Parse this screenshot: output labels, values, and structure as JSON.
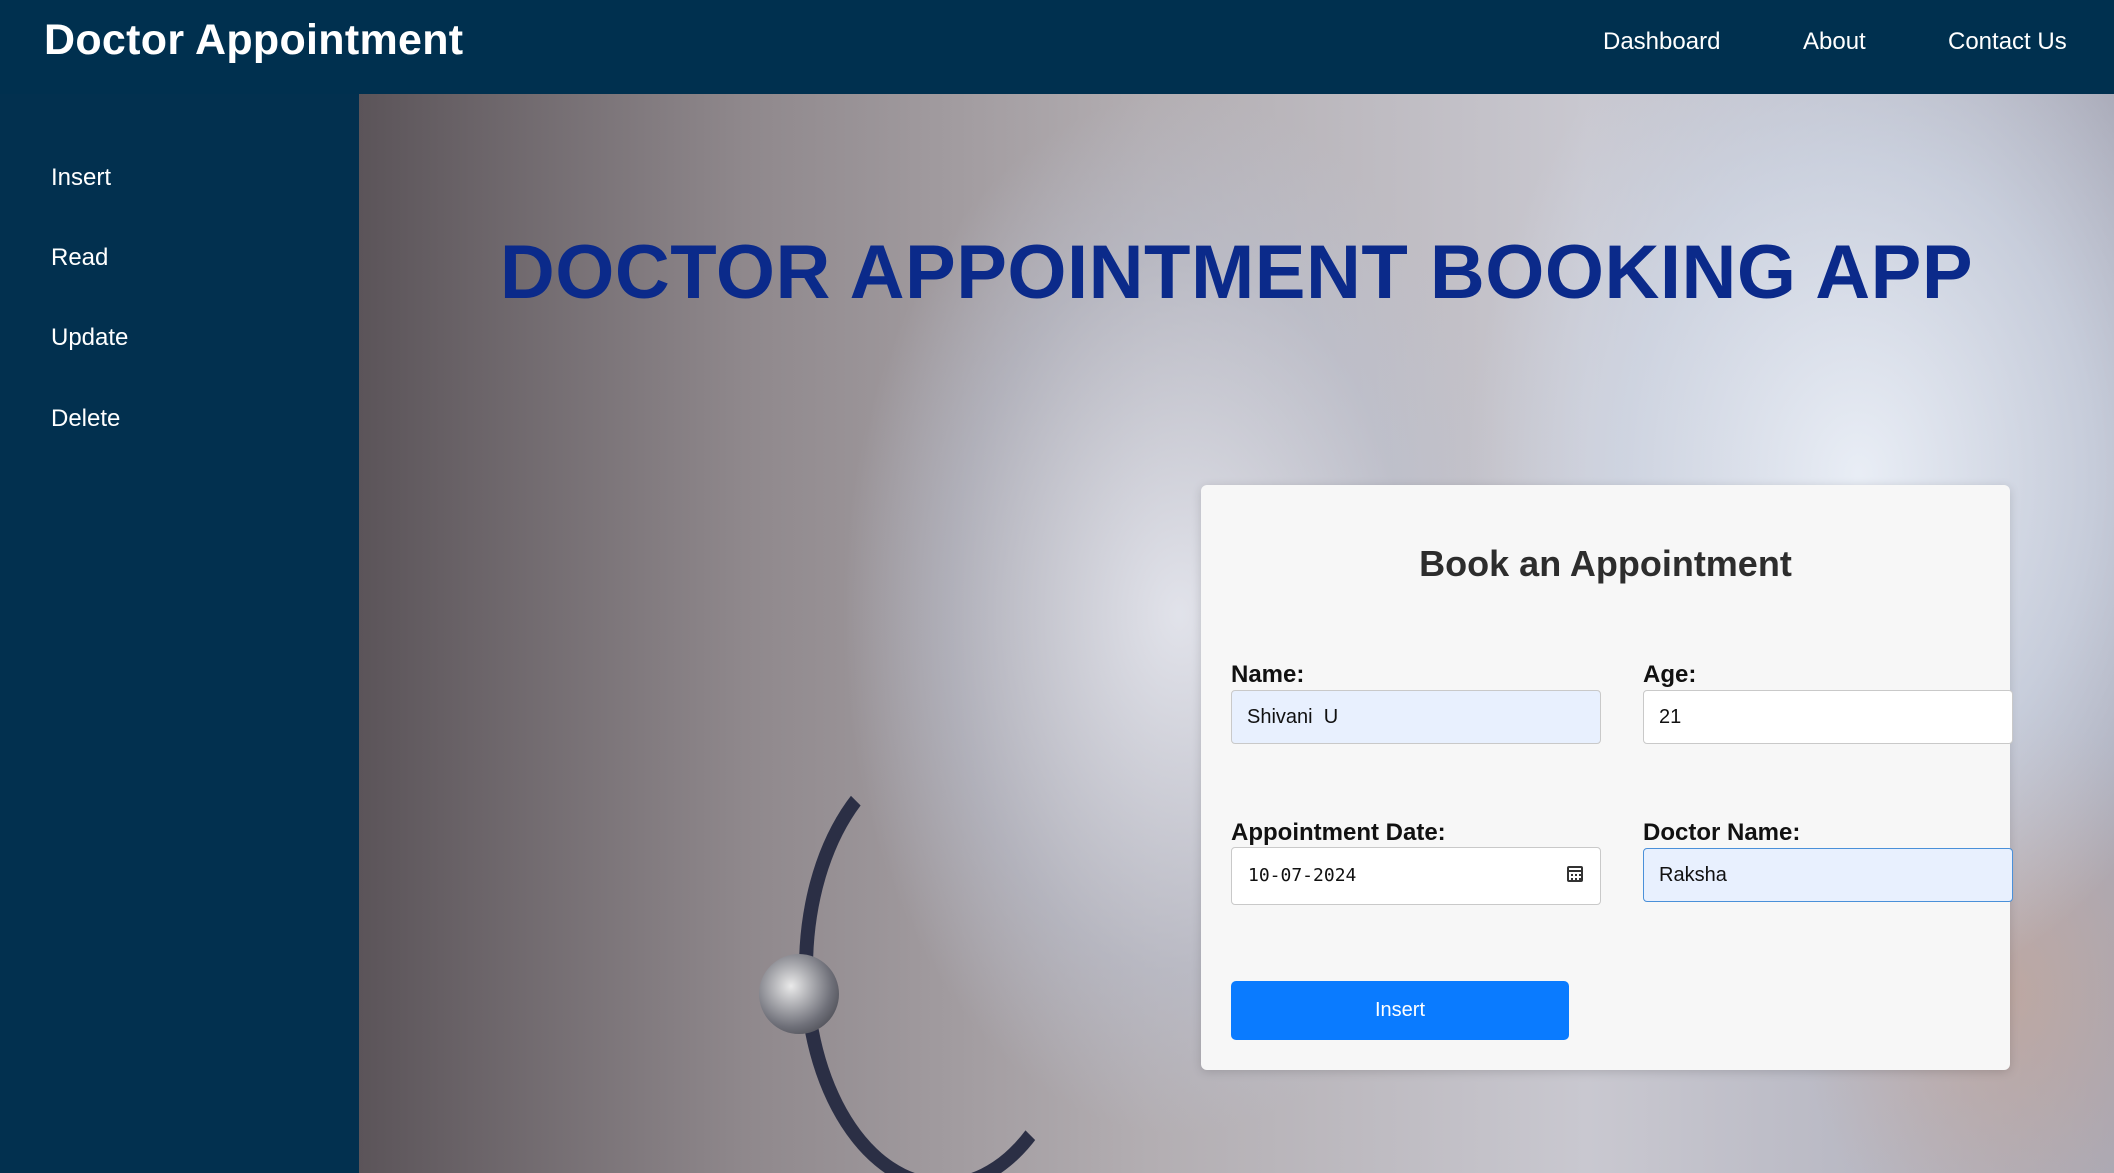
{
  "header": {
    "brand": "Doctor Appointment",
    "nav": [
      "Dashboard",
      "About",
      "Contact Us"
    ]
  },
  "sidebar": {
    "items": [
      "Insert",
      "Read",
      "Update",
      "Delete"
    ]
  },
  "hero": {
    "title": "DOCTOR APPOINTMENT BOOKING APP"
  },
  "form": {
    "title": "Book an Appointment",
    "name_label": "Name:",
    "name_value": "Shivani  U",
    "age_label": "Age:",
    "age_value": "21",
    "date_label": "Appointment Date:",
    "date_value": "10-07-2024",
    "doctor_label": "Doctor Name:",
    "doctor_value": "Raksha",
    "submit_label": "Insert"
  },
  "colors": {
    "header_bg": "#00304f",
    "sidebar_bg": "#02304f",
    "title_color": "#0b2a8a",
    "button_bg": "#0a7bff",
    "autofill_bg": "#e8f0fe"
  },
  "icons": {
    "date_picker": "calendar-icon"
  }
}
